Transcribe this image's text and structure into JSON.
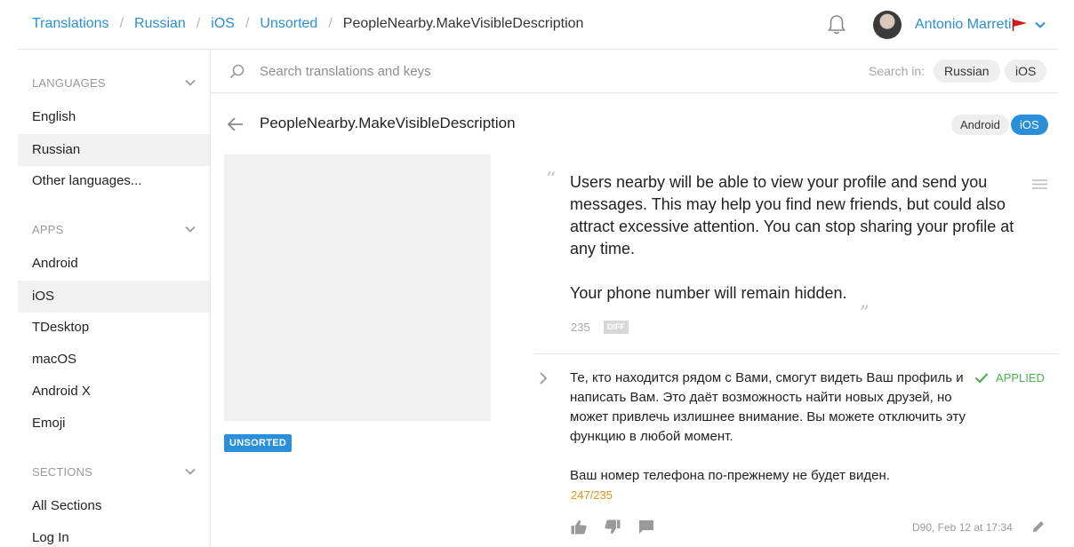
{
  "breadcrumb": {
    "items": [
      "Translations",
      "Russian",
      "iOS",
      "Unsorted"
    ],
    "current": "PeopleNearby.MakeVisibleDescription",
    "separator": "/"
  },
  "user": {
    "name": "Antonio Marreti"
  },
  "sidebar": {
    "languages": {
      "heading": "LANGUAGES",
      "items": [
        "English",
        "Russian",
        "Other languages..."
      ],
      "active": "Russian"
    },
    "apps": {
      "heading": "APPS",
      "items": [
        "Android",
        "iOS",
        "TDesktop",
        "macOS",
        "Android X",
        "Emoji"
      ],
      "active": "iOS"
    },
    "sections": {
      "heading": "SECTIONS",
      "items": [
        "All Sections",
        "Log In"
      ]
    }
  },
  "search": {
    "placeholder": "Search translations and keys",
    "value": "",
    "search_in_label": "Search in:",
    "filters": [
      "Russian",
      "iOS"
    ]
  },
  "key": {
    "name": "PeopleNearby.MakeVisibleDescription",
    "platforms": [
      "Android",
      "iOS"
    ],
    "active_platform": "iOS",
    "badge": "UNSORTED"
  },
  "source": {
    "quote_open": "“",
    "quote_close": "„",
    "text": "Users nearby will be able to view your profile and send you messages. This may help you find new friends, but could also attract excessive attention. You can stop sharing your profile at any time.\n\nYour phone number will remain hidden.",
    "char_count": "235",
    "diff_label": "DIFF"
  },
  "translation": {
    "text": "Те, кто находится рядом с Вами, смогут видеть Ваш профиль и написать Вам. Это даёт возможность найти новых друзей, но может привлечь излишнее внимание. Вы можете отключить эту функцию в любой момент.\n\nВаш номер телефона по-прежнему не будет виден.",
    "status": "APPLIED",
    "char_count": "247/235",
    "meta": "D90, Feb 12 at 17:34"
  },
  "colors": {
    "accent": "#2a8fd8",
    "applied": "#4caf50",
    "over_limit": "#e8941a",
    "active_bg": "#f1f1f1"
  },
  "icons": [
    "bell-icon",
    "chevron-down-icon",
    "flag-icon",
    "search-icon",
    "back-arrow-icon",
    "menu-icon",
    "chevron-right-icon",
    "check-icon",
    "thumbs-up-icon",
    "thumbs-down-icon",
    "comment-icon",
    "edit-icon"
  ]
}
